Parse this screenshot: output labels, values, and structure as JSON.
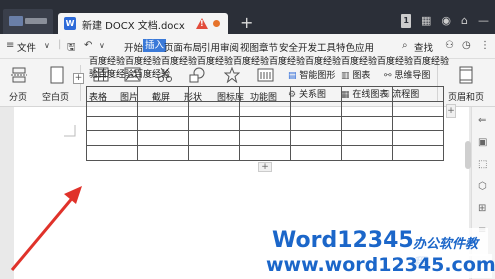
{
  "titlebar": {
    "doc_title": "新建 DOCX 文档.docx",
    "new_tab": "+",
    "win_badge": "1",
    "colors": {
      "bg": "#2b2f38",
      "tab": "#f4f4f4",
      "warn": "#e24b3b",
      "doc_icon": "#2d6ad8"
    }
  },
  "menubar": {
    "menu_icon": "≡",
    "file": "文件",
    "chevron": "∨",
    "items": [
      "开始",
      "插入",
      "页面布局",
      "引用",
      "审阅",
      "视图",
      "章节",
      "安全",
      "开发工具",
      "特色应用"
    ],
    "active": "插入",
    "search": "查找",
    "accent": "#3a79d8"
  },
  "ribbon": {
    "page_break": "分页",
    "blank_page": "空白页",
    "table": "表格",
    "picture": "图片",
    "screenshot": "截屏",
    "shape": "形状",
    "icon_lib": "图标库",
    "func_chart": "功能图",
    "smart_shape": "智能图形",
    "chart": "图表",
    "mind_map": "思维导图",
    "relation": "关系图",
    "online_chart": "在线图表",
    "flowchart": "流程图",
    "header_footer": "页眉和页"
  },
  "document": {
    "paragraph_line1": "百度经验百度经验百度经验百度经验百度经验百度经验百度经验百度经验百度经验百度经验",
    "paragraph_line2": "验百度经验百度经验",
    "table_handle": "+",
    "add_col": "+",
    "add_row": "+"
  },
  "watermark": {
    "line1_brand": "Word12345",
    "line1_cn": "办公软件教程",
    "line2": "www.word12345.com"
  },
  "annotation": {
    "arrow_color": "#e0322a"
  }
}
